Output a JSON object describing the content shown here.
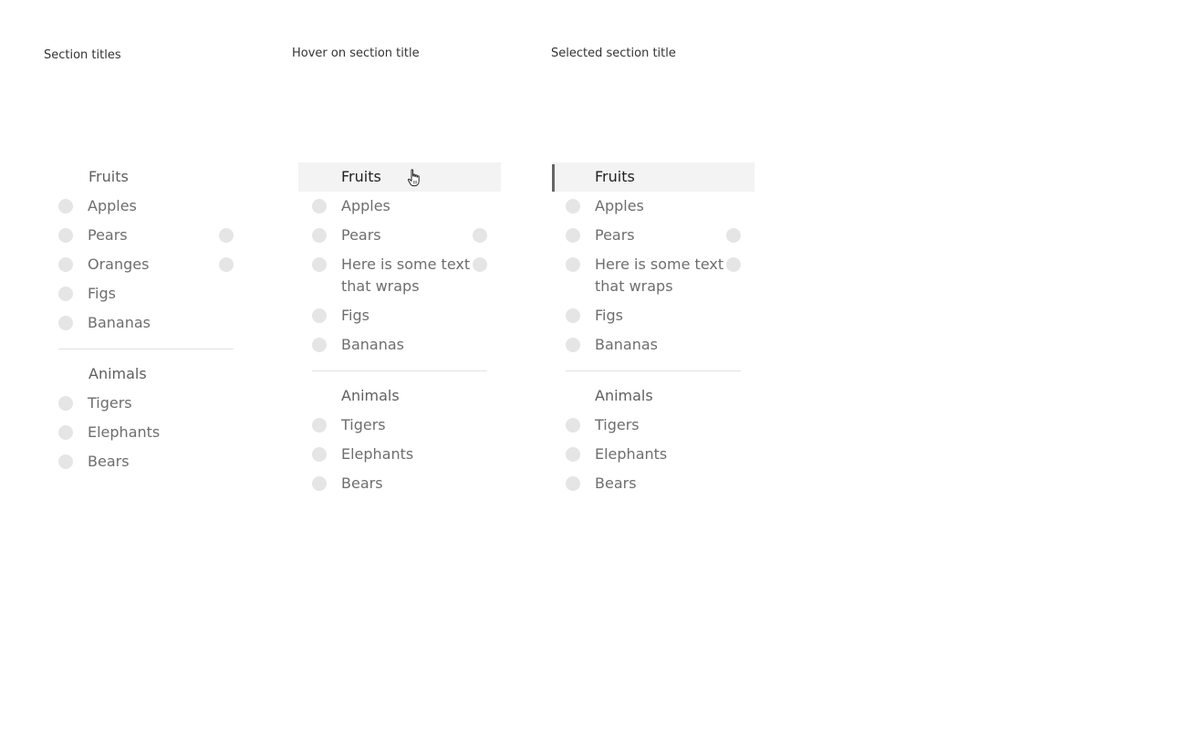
{
  "labels": {
    "col1": "Section titles",
    "col2": "Hover on section title",
    "col3": "Selected section title"
  },
  "panel1": {
    "fruits_title": "Fruits",
    "fruits": [
      "Apples",
      "Pears",
      "Oranges",
      "Figs",
      "Bananas"
    ],
    "animals_title": "Animals",
    "animals": [
      "Tigers",
      "Elephants",
      "Bears"
    ]
  },
  "panel2": {
    "fruits_title": "Fruits",
    "fruits": [
      "Apples",
      "Pears",
      "Here is some text that wraps",
      "Figs",
      "Bananas"
    ],
    "animals_title": "Animals",
    "animals": [
      "Tigers",
      "Elephants",
      "Bears"
    ]
  },
  "panel3": {
    "fruits_title": "Fruits",
    "fruits": [
      "Apples",
      "Pears",
      "Here is some text that wraps",
      "Figs",
      "Bananas"
    ],
    "animals_title": "Animals",
    "animals": [
      "Tigers",
      "Elephants",
      "Bears"
    ]
  },
  "icons": {
    "status_dot": "circle-icon",
    "cursor": "hand-pointer-icon"
  },
  "colors": {
    "dot": "#e5e5e5",
    "hover_bg": "#f3f3f3",
    "selected_bar": "#666666",
    "divider": "#e2e2e2"
  }
}
